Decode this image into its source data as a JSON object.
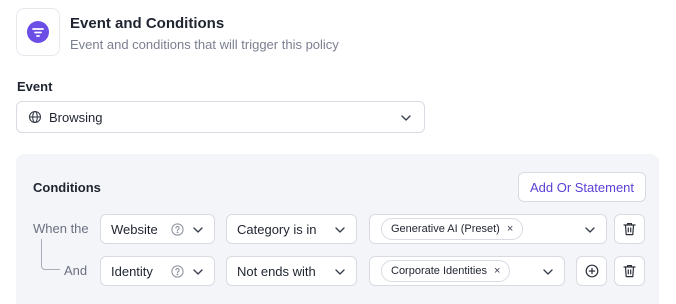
{
  "header": {
    "title": "Event and Conditions",
    "subtitle": "Event and conditions that will trigger this policy",
    "icon": "filter-lines-icon",
    "accent": "#6c4ee6"
  },
  "event": {
    "label": "Event",
    "selected": "Browsing",
    "icon": "globe-icon"
  },
  "conditions": {
    "title": "Conditions",
    "add_or_label": "Add Or Statement",
    "accent": "#5b3fd6",
    "rows": [
      {
        "prefix": "When the",
        "field": "Website",
        "operator": "Category is in",
        "values": [
          {
            "label": "Generative AI (Preset)",
            "remove": "×"
          }
        ]
      },
      {
        "prefix": "And",
        "field": "Identity",
        "operator": "Not ends with",
        "values": [
          {
            "label": "Corporate Identities",
            "remove": "×"
          }
        ]
      }
    ]
  }
}
